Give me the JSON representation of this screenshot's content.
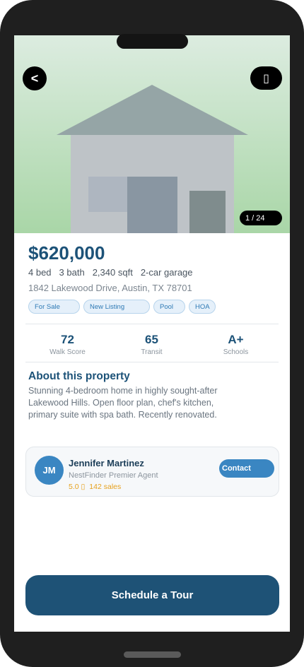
{
  "hero": {
    "back_icon": "<",
    "share_icon": "▯",
    "photo_counter": "1 / 24"
  },
  "listing": {
    "price": "$620,000",
    "specs": [
      "4 bed",
      "3 bath",
      "2,340 sqft",
      "2-car garage"
    ],
    "address": "1842 Lakewood Drive, Austin, TX 78701",
    "tags": [
      "For Sale",
      "New Listing",
      "Pool",
      "HOA"
    ]
  },
  "scores": [
    {
      "value": "72",
      "label": "Walk Score"
    },
    {
      "value": "65",
      "label": "Transit"
    },
    {
      "value": "A+",
      "label": "Schools"
    }
  ],
  "about": {
    "title": "About this property",
    "text": "Stunning 4-bedroom home in highly sought-after Lakewood Hills. Open floor plan, chef's kitchen, primary suite with spa bath. Recently renovated."
  },
  "agent": {
    "initials": "JM",
    "name": "Jennifer Martinez",
    "role": "NestFinder Premier Agent",
    "rating": "5.0 ▯",
    "sales": "142 sales",
    "contact_label": "Contact"
  },
  "cta": {
    "tour_label": "Schedule a Tour"
  },
  "colors": {
    "brand": "#1c5278",
    "accent": "#3a86c2",
    "rating": "#e6a11e",
    "cta": "#1e5276"
  }
}
